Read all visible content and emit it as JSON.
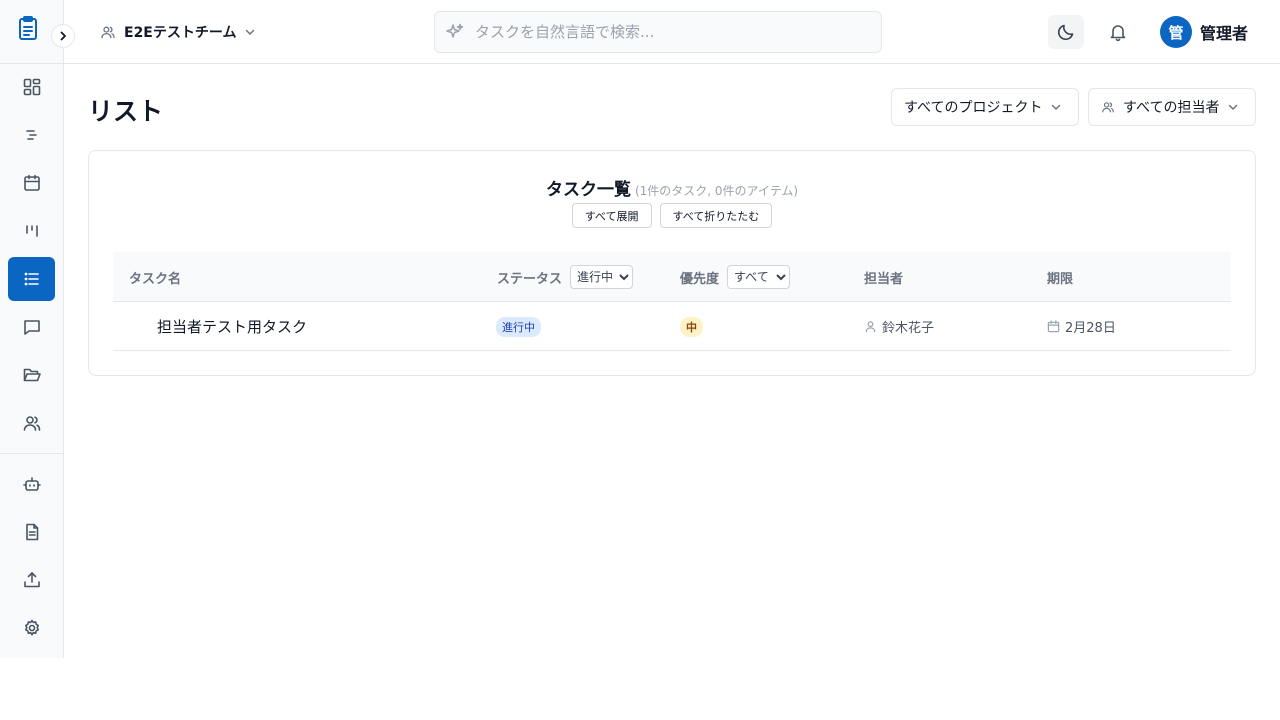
{
  "colors": {
    "accent": "#0a66c2",
    "status_bg": "#dbeafe",
    "priority_bg": "#fef3c7"
  },
  "sidebar": {
    "items": [
      {
        "name": "dashboard",
        "icon": "layout-grid-icon"
      },
      {
        "name": "timeline",
        "icon": "gantt-icon"
      },
      {
        "name": "calendar",
        "icon": "calendar-icon"
      },
      {
        "name": "kanban",
        "icon": "kanban-icon"
      },
      {
        "name": "list",
        "icon": "list-icon",
        "active": true
      },
      {
        "name": "chat",
        "icon": "message-square-icon"
      },
      {
        "name": "projects",
        "icon": "folder-open-icon"
      },
      {
        "name": "members",
        "icon": "users-icon"
      },
      {
        "name": "ai",
        "icon": "bot-icon"
      },
      {
        "name": "documents",
        "icon": "file-text-icon"
      },
      {
        "name": "upload",
        "icon": "upload-icon"
      },
      {
        "name": "settings",
        "icon": "gear-icon"
      }
    ]
  },
  "header": {
    "team": "E2Eテストチーム",
    "search_placeholder": "タスクを自然言語で検索...",
    "user_initial": "管",
    "user_name": "管理者"
  },
  "main": {
    "title": "リスト",
    "filters": {
      "project": "すべてのプロジェクト",
      "assignee": "すべての担当者"
    },
    "card": {
      "title": "タスク一覧",
      "subtitle": "(1件のタスク, 0件のアイテム)",
      "expand_all": "すべて展開",
      "collapse_all": "すべて折りたたむ"
    },
    "table": {
      "headers": {
        "name": "タスク名",
        "status": "ステータス",
        "status_filter": "進行中",
        "priority": "優先度",
        "priority_filter": "すべて",
        "assignee": "担当者",
        "due": "期限"
      },
      "rows": [
        {
          "name": "担当者テスト用タスク",
          "status": "進行中",
          "priority": "中",
          "assignee": "鈴木花子",
          "due": "2月28日"
        }
      ]
    }
  }
}
